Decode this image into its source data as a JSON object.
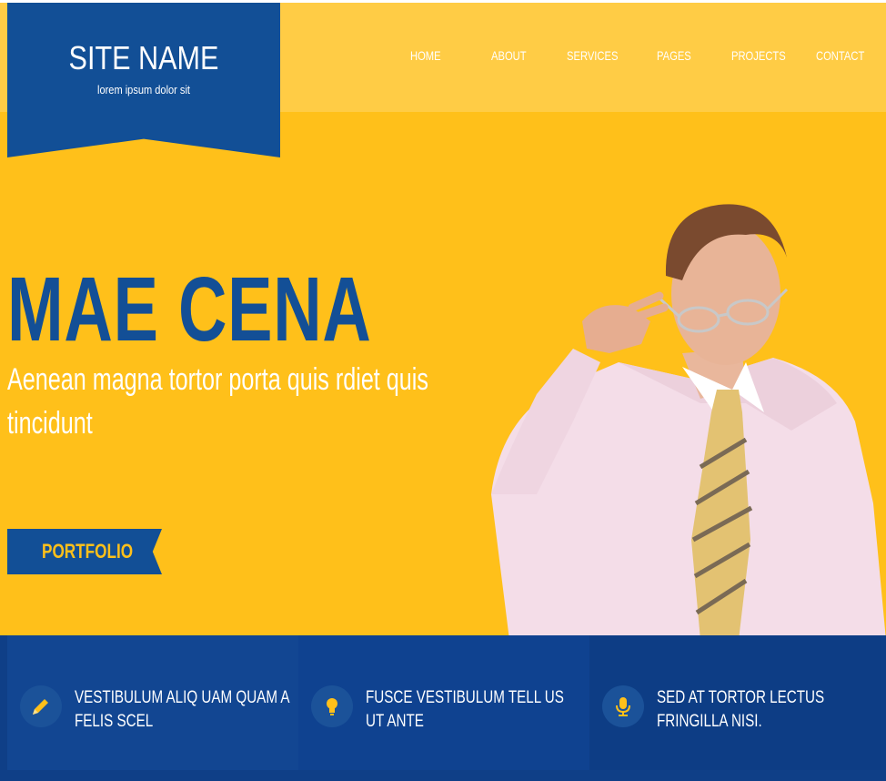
{
  "brand": {
    "name": "SITE NAME",
    "tagline": "lorem ipsum dolor sit",
    "colors": {
      "primary_blue": "#124f96",
      "accent_yellow": "#ffc01a",
      "topbar_yellow": "#ffcc45"
    }
  },
  "nav": {
    "items": [
      {
        "label": "HOME"
      },
      {
        "label": "ABOUT"
      },
      {
        "label": "SERVICES"
      },
      {
        "label": "PAGES"
      },
      {
        "label": "PROJECTS"
      },
      {
        "label": "CONTACT"
      }
    ]
  },
  "hero": {
    "title": "MAE CENA",
    "subtitle": "Aenean magna tortor porta quis rdiet quis tincidunt",
    "button_label": "PORTFOLIO",
    "image": "businessman-adjusting-glasses"
  },
  "features": [
    {
      "icon": "pencil-icon",
      "text": "VESTIBULUM ALIQ UAM QUAM A FELIS SCEL"
    },
    {
      "icon": "lightbulb-icon",
      "text": "FUSCE VESTIBULUM TELL US UT ANTE"
    },
    {
      "icon": "microphone-icon",
      "text": "SED AT TORTOR LECTUS FRINGILLA NISI."
    }
  ]
}
